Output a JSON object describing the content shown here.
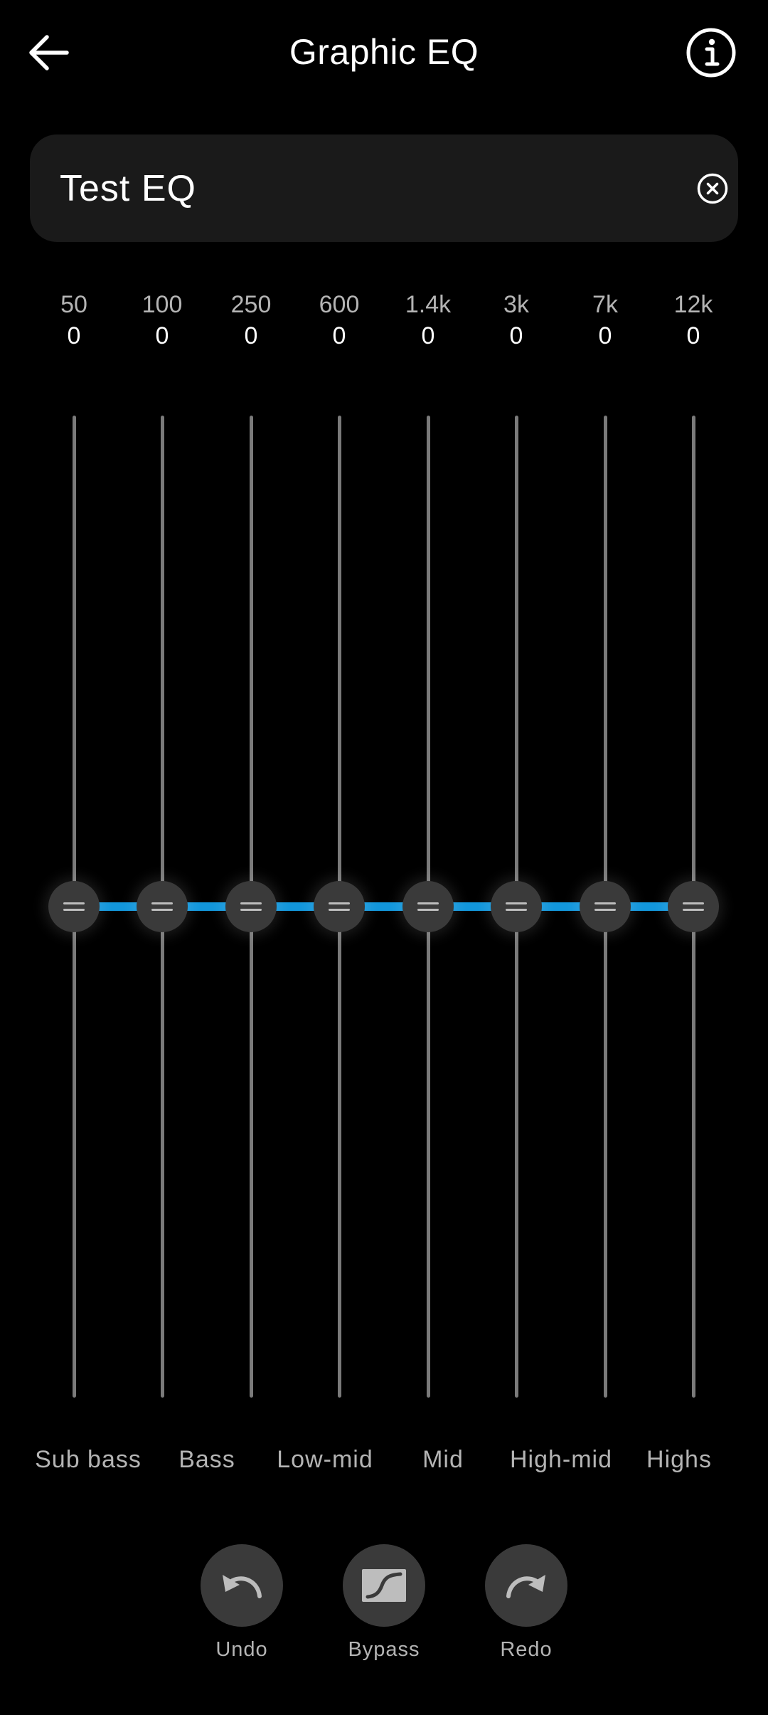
{
  "header": {
    "title": "Graphic EQ",
    "back_icon": "arrow-left-icon",
    "info_icon": "info-icon"
  },
  "preset": {
    "name": "Test EQ",
    "clear_icon": "close-circle-icon"
  },
  "bands": [
    {
      "freq": "50",
      "gain": "0"
    },
    {
      "freq": "100",
      "gain": "0"
    },
    {
      "freq": "250",
      "gain": "0"
    },
    {
      "freq": "600",
      "gain": "0"
    },
    {
      "freq": "1.4k",
      "gain": "0"
    },
    {
      "freq": "3k",
      "gain": "0"
    },
    {
      "freq": "7k",
      "gain": "0"
    },
    {
      "freq": "12k",
      "gain": "0"
    }
  ],
  "ranges": [
    "Sub bass",
    "Bass",
    "Low-mid",
    "Mid",
    "High-mid",
    "Highs"
  ],
  "actions": {
    "undo": {
      "label": "Undo",
      "icon": "undo-icon"
    },
    "bypass": {
      "label": "Bypass",
      "icon": "bypass-icon"
    },
    "redo": {
      "label": "Redo",
      "icon": "redo-icon"
    }
  },
  "colors": {
    "background": "#000000",
    "accent": "#1296db",
    "track": "#7a7a7a",
    "thumb": "#3a3a3a",
    "field": "#1a1a1a",
    "muted_text": "#b4b4b4"
  }
}
